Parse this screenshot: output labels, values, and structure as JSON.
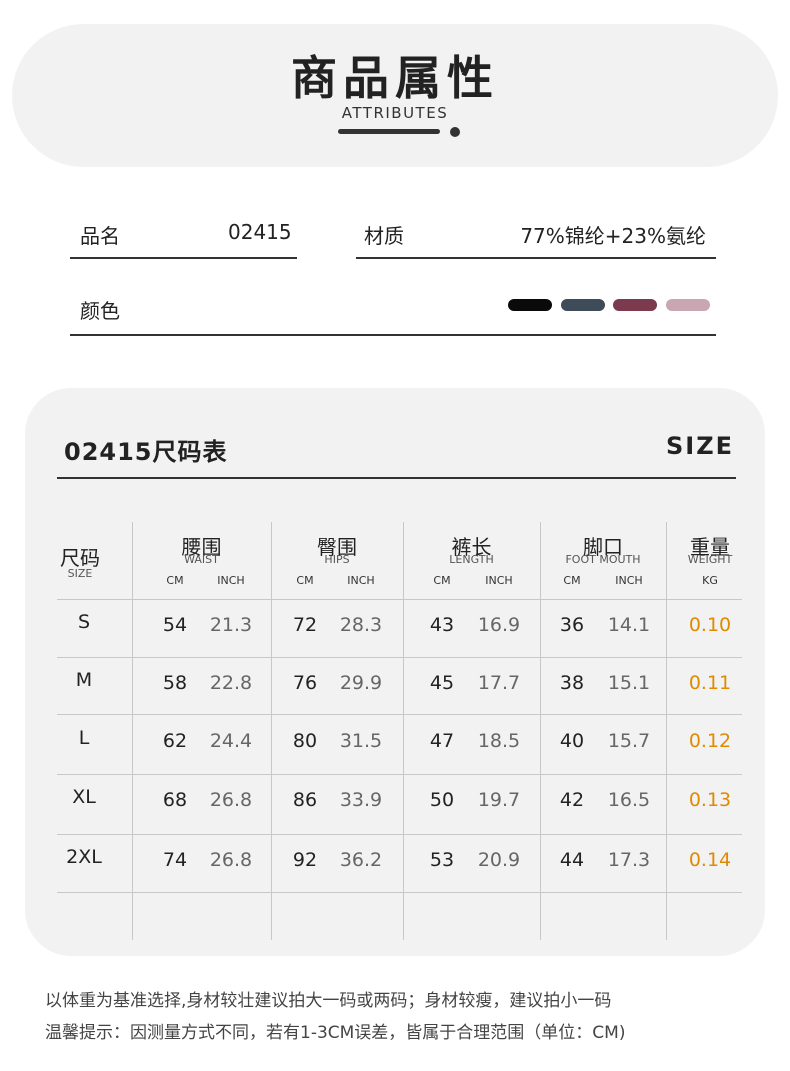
{
  "header": {
    "title": "商品属性",
    "subtitle": "ATTRIBUTES"
  },
  "attributes": {
    "name_label": "品名",
    "name_value": "02415",
    "material_label": "材质",
    "material_value": "77%锦纶+23%氨纶",
    "color_label": "颜色",
    "colors": [
      "#0a0a0a",
      "#3e4c5a",
      "#7b3a4e",
      "#c9a6b1"
    ]
  },
  "size_chart": {
    "title": "02415尺码表",
    "size_tag": "SIZE",
    "columns": {
      "size": {
        "cn": "尺码",
        "en": "SIZE"
      },
      "waist": {
        "cn": "腰围",
        "en": "WAIST"
      },
      "hips": {
        "cn": "臀围",
        "en": "HIPS"
      },
      "length": {
        "cn": "裤长",
        "en": "LENGTH"
      },
      "foot": {
        "cn": "脚口",
        "en": "FOOT MOUTH"
      },
      "weight": {
        "cn": "重量",
        "en": "WEIGHT"
      }
    },
    "units": {
      "cm": "CM",
      "inch": "INCH",
      "kg": "KG"
    },
    "rows": [
      {
        "size": "S",
        "waist_cm": "54",
        "waist_in": "21.3",
        "hips_cm": "72",
        "hips_in": "28.3",
        "length_cm": "43",
        "length_in": "16.9",
        "foot_cm": "36",
        "foot_in": "14.1",
        "weight": "0.10"
      },
      {
        "size": "M",
        "waist_cm": "58",
        "waist_in": "22.8",
        "hips_cm": "76",
        "hips_in": "29.9",
        "length_cm": "45",
        "length_in": "17.7",
        "foot_cm": "38",
        "foot_in": "15.1",
        "weight": "0.11"
      },
      {
        "size": "L",
        "waist_cm": "62",
        "waist_in": "24.4",
        "hips_cm": "80",
        "hips_in": "31.5",
        "length_cm": "47",
        "length_in": "18.5",
        "foot_cm": "40",
        "foot_in": "15.7",
        "weight": "0.12"
      },
      {
        "size": "XL",
        "waist_cm": "68",
        "waist_in": "26.8",
        "hips_cm": "86",
        "hips_in": "33.9",
        "length_cm": "50",
        "length_in": "19.7",
        "foot_cm": "42",
        "foot_in": "16.5",
        "weight": "0.13"
      },
      {
        "size": "2XL",
        "waist_cm": "74",
        "waist_in": "26.8",
        "hips_cm": "92",
        "hips_in": "36.2",
        "length_cm": "53",
        "length_in": "20.9",
        "foot_cm": "44",
        "foot_in": "17.3",
        "weight": "0.14"
      }
    ]
  },
  "notes": {
    "line1": "以体重为基准选择,身材较壮建议拍大一码或两码；身材较瘦，建议拍小一码",
    "line2": "温馨提示：因测量方式不同，若有1-3CM误差，皆属于合理范围（单位：CM)"
  }
}
